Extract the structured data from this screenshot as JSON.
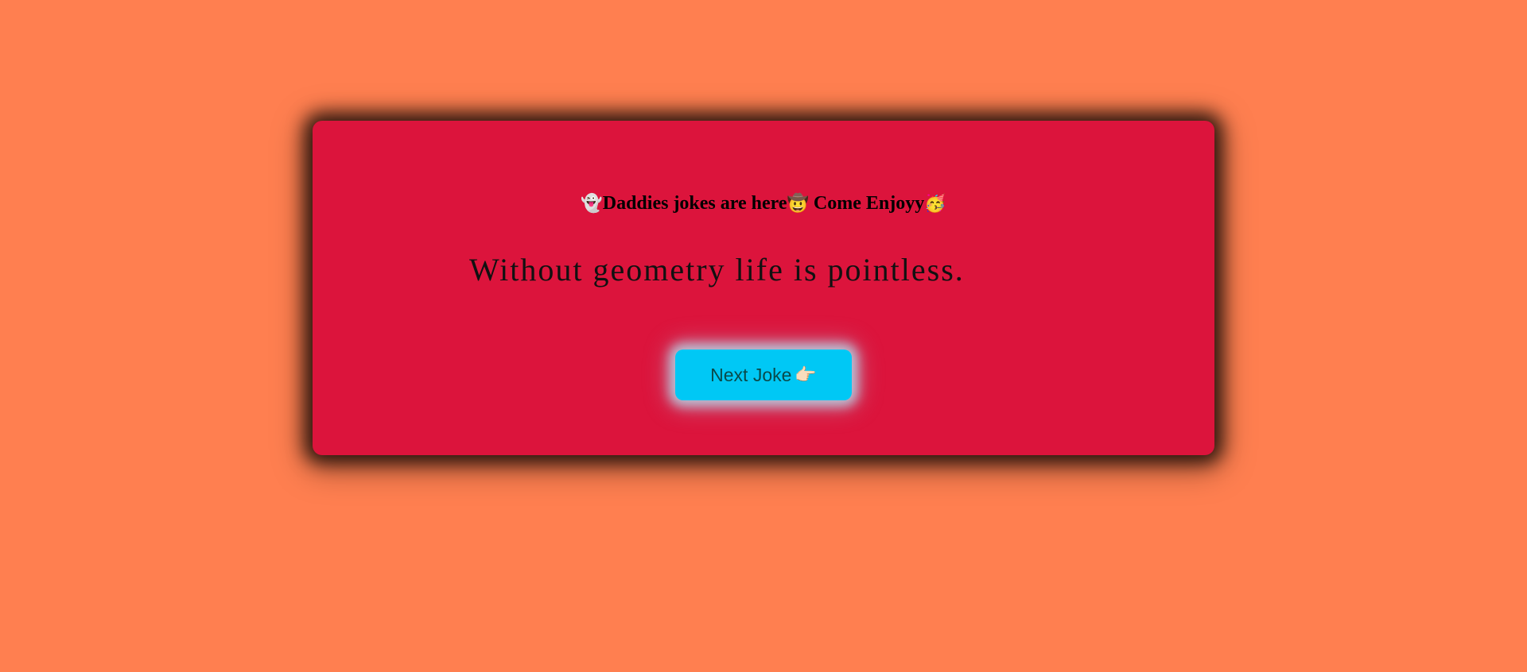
{
  "colors": {
    "page_background": "#ff7f50",
    "card_background": "#dc143c",
    "button_background": "#00c8f5",
    "button_text": "#0a4a4a"
  },
  "card": {
    "heading": {
      "emoji_ghost": "👻",
      "text_1": "Daddies jokes are here",
      "emoji_cowboy": "🤠",
      "text_2": " Come Enjoyy",
      "emoji_party": "🥳"
    },
    "joke_text": "Without geometry life is pointless.",
    "next_button": {
      "label": "Next Joke",
      "icon": "👉🏻"
    }
  },
  "icons": {
    "ghost": "ghost-icon",
    "cowboy": "cowboy-face-icon",
    "party": "party-face-icon",
    "pointing": "pointing-right-icon"
  }
}
